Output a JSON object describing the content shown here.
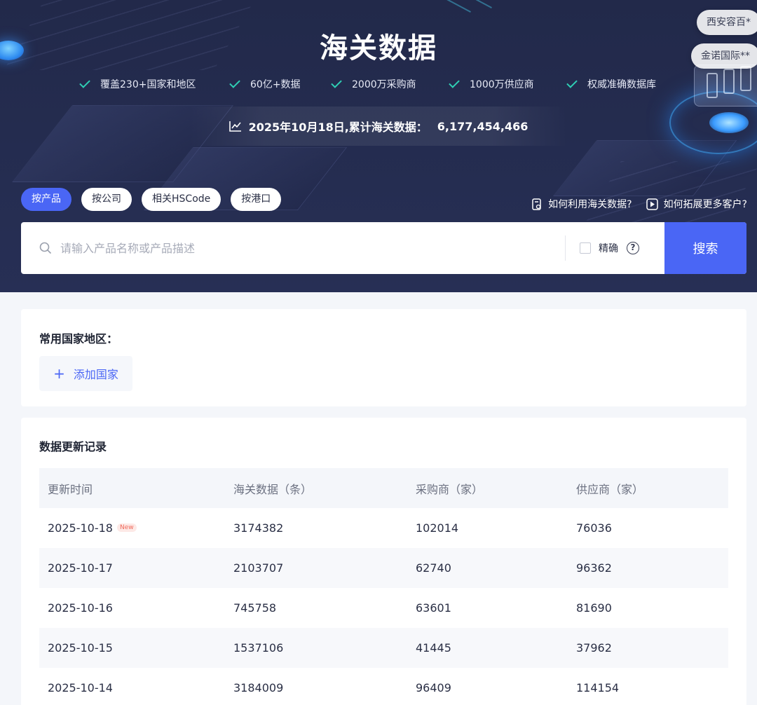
{
  "hero": {
    "title": "海关数据",
    "features": [
      "覆盖230+国家和地区",
      "60亿+数据",
      "2000万采购商",
      "1000万供应商",
      "权威准确数据库"
    ],
    "stat_text": "2025年10月18日,累计海关数据：",
    "stat_value": "6,177,454,466",
    "company_chips": [
      "西安容百*",
      "金诺国际**"
    ]
  },
  "search": {
    "tabs": [
      "按产品",
      "按公司",
      "相关HSCode",
      "按港口"
    ],
    "active_tab": 0,
    "help_links": [
      "如何利用海关数据?",
      "如何拓展更多客户?"
    ],
    "placeholder": "请输入产品名称或产品描述",
    "exact_label": "精确",
    "help_symbol": "?",
    "button_label": "搜索"
  },
  "countries": {
    "title": "常用国家地区：",
    "add_label": "添加国家",
    "plus": "+"
  },
  "updates": {
    "title": "数据更新记录",
    "columns": [
      "更新时间",
      "海关数据（条）",
      "采购商（家）",
      "供应商（家）"
    ],
    "new_badge": "New",
    "rows": [
      {
        "date": "2025-10-18",
        "records": "3174382",
        "buyers": "102014",
        "suppliers": "76036"
      },
      {
        "date": "2025-10-17",
        "records": "2103707",
        "buyers": "62740",
        "suppliers": "96362"
      },
      {
        "date": "2025-10-16",
        "records": "745758",
        "buyers": "63601",
        "suppliers": "81690"
      },
      {
        "date": "2025-10-15",
        "records": "1537106",
        "buyers": "41445",
        "suppliers": "37962"
      },
      {
        "date": "2025-10-14",
        "records": "3184009",
        "buyers": "96409",
        "suppliers": "114154"
      }
    ]
  },
  "colors": {
    "accent": "#4a66f5",
    "check": "#2fcfb4",
    "hero_bg": "#242c4f",
    "new_badge": "#f06a5c"
  },
  "icons": {
    "feature": "check-icon",
    "stat": "trend-chart-icon",
    "search": "search-icon",
    "help_links": [
      "document-icon",
      "play-icon"
    ]
  }
}
